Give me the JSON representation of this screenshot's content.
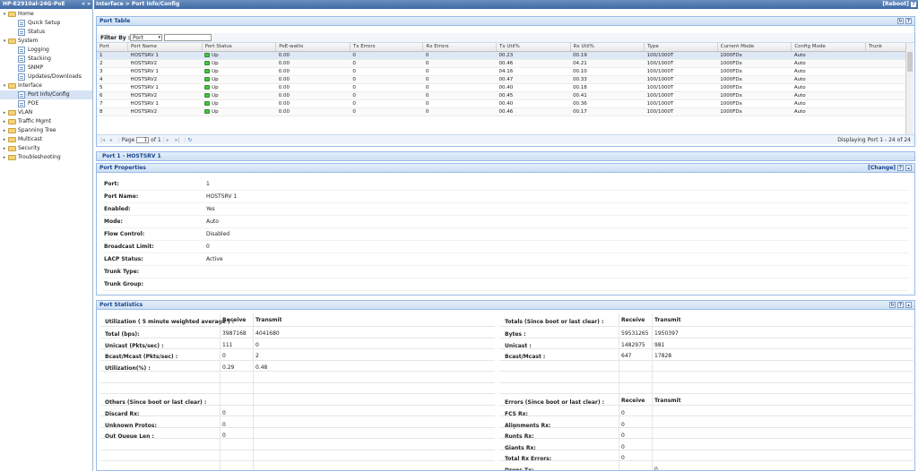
{
  "device": {
    "name": "HP-E2910al-24G-PoE",
    "nav_arrows": "« »"
  },
  "tree": [
    {
      "label": "Home",
      "type": "folder",
      "toggle": "▾",
      "level": 0
    },
    {
      "label": "Quick Setup",
      "type": "page",
      "level": 1
    },
    {
      "label": "Status",
      "type": "page",
      "level": 1
    },
    {
      "label": "System",
      "type": "folder",
      "toggle": "▾",
      "level": 0
    },
    {
      "label": "Logging",
      "type": "page",
      "level": 1
    },
    {
      "label": "Stacking",
      "type": "page",
      "level": 1
    },
    {
      "label": "SNMP",
      "type": "page",
      "level": 1
    },
    {
      "label": "Updates/Downloads",
      "type": "page",
      "level": 1
    },
    {
      "label": "Interface",
      "type": "folder",
      "toggle": "▾",
      "level": 0
    },
    {
      "label": "Port Info/Config",
      "type": "page",
      "level": 1,
      "selected": true
    },
    {
      "label": "POE",
      "type": "page",
      "level": 1
    },
    {
      "label": "VLAN",
      "type": "folder",
      "toggle": "▸",
      "level": 0
    },
    {
      "label": "Traffic Mgmt",
      "type": "folder",
      "toggle": "▸",
      "level": 0
    },
    {
      "label": "Spanning Tree",
      "type": "folder",
      "toggle": "▸",
      "level": 0
    },
    {
      "label": "Multicast",
      "type": "folder",
      "toggle": "▸",
      "level": 0
    },
    {
      "label": "Security",
      "type": "folder",
      "toggle": "▸",
      "level": 0
    },
    {
      "label": "Troubleshooting",
      "type": "folder",
      "toggle": "▸",
      "level": 0
    }
  ],
  "header": {
    "breadcrumb": "Interface > Port Info/Config",
    "reboot": "[Reboot]"
  },
  "port_table": {
    "title": "Port Table",
    "filter_label": "Filter By :",
    "filter_select": "Port",
    "columns": [
      "Port",
      "Port Name",
      "Port Status",
      "PoE-watts",
      "Tx Errors",
      "Rx Errors",
      "Tx Util%",
      "Rx Util%",
      "Type",
      "Current Mode",
      "Config Mode",
      "Trunk"
    ],
    "rows": [
      [
        "1",
        "HOSTSRV 1",
        "Up",
        "0.00",
        "0",
        "0",
        "00.23",
        "00.19",
        "100/1000T",
        "1000FDx",
        "Auto",
        ""
      ],
      [
        "2",
        "HOSTSRV2",
        "Up",
        "0.00",
        "0",
        "0",
        "00.46",
        "04.21",
        "100/1000T",
        "1000FDx",
        "Auto",
        ""
      ],
      [
        "3",
        "HOSTSRV 1",
        "Up",
        "0.00",
        "0",
        "0",
        "04.16",
        "00.10",
        "100/1000T",
        "1000FDx",
        "Auto",
        ""
      ],
      [
        "4",
        "HOSTSRV2",
        "Up",
        "0.00",
        "0",
        "0",
        "00.47",
        "00.33",
        "100/1000T",
        "1000FDx",
        "Auto",
        ""
      ],
      [
        "5",
        "HOSTSRV 1",
        "Up",
        "0.00",
        "0",
        "0",
        "00.40",
        "00.18",
        "100/1000T",
        "1000FDx",
        "Auto",
        ""
      ],
      [
        "6",
        "HOSTSRV2",
        "Up",
        "0.00",
        "0",
        "0",
        "00.45",
        "00.41",
        "100/1000T",
        "1000FDx",
        "Auto",
        ""
      ],
      [
        "7",
        "HOSTSRV 1",
        "Up",
        "0.00",
        "0",
        "0",
        "00.40",
        "00.36",
        "100/1000T",
        "1000FDx",
        "Auto",
        ""
      ],
      [
        "8",
        "HOSTSRV2",
        "Up",
        "0.00",
        "0",
        "0",
        "00.46",
        "00.17",
        "100/1000T",
        "1000FDx",
        "Auto",
        ""
      ]
    ],
    "pager": {
      "page_label": "Page",
      "page_value": "1",
      "of": "of 1",
      "display": "Displaying Port 1 - 24 of 24"
    }
  },
  "detail_title": "Port 1 - HOSTSRV 1",
  "port_properties": {
    "title": "Port Properties",
    "change": "[Change]",
    "rows": [
      {
        "k": "Port:",
        "v": "1"
      },
      {
        "k": "Port Name:",
        "v": "HOSTSRV 1"
      },
      {
        "k": "Enabled:",
        "v": "Yes"
      },
      {
        "k": "Mode:",
        "v": "Auto"
      },
      {
        "k": "Flow Control:",
        "v": "Disabled"
      },
      {
        "k": "Broadcast Limit:",
        "v": "0"
      },
      {
        "k": "LACP Status:",
        "v": "Active"
      },
      {
        "k": "Trunk Type:",
        "v": ""
      },
      {
        "k": "Trunk Group:",
        "v": ""
      }
    ]
  },
  "port_statistics": {
    "title": "Port Statistics",
    "util_header": "Utilization ( 5 minute weighted average ) :",
    "receive": "Receive",
    "transmit": "Transmit",
    "left": [
      {
        "k": "Total (bps):",
        "r": "3987168",
        "t": "4041680"
      },
      {
        "k": "Unicast (Pkts/sec) :",
        "r": "111",
        "t": "0"
      },
      {
        "k": "Bcast/Mcast (Pkts/sec) :",
        "r": "0",
        "t": "2"
      },
      {
        "k": "Utilization(%) :",
        "r": "0.29",
        "t": "0.48"
      }
    ],
    "totals_header": "Totals (Since boot or last clear) :",
    "right": [
      {
        "k": "Bytes :",
        "r": "59531265",
        "t": "1950397"
      },
      {
        "k": "Unicast :",
        "r": "1482975",
        "t": "981"
      },
      {
        "k": "Bcast/Mcast :",
        "r": "647",
        "t": "17828"
      }
    ],
    "others_header": "Others (Since boot or last clear) :",
    "others": [
      {
        "k": "Discard Rx:",
        "v": "0"
      },
      {
        "k": "Unknown Protos:",
        "v": "0"
      },
      {
        "k": "Out Queue Len :",
        "v": "0"
      }
    ],
    "errors_header": "Errors (Since boot or last clear) :",
    "errors": [
      {
        "k": "FCS Rx:",
        "r": "0",
        "t": ""
      },
      {
        "k": "Alignments Rx:",
        "r": "0",
        "t": ""
      },
      {
        "k": "Runts Rx:",
        "r": "0",
        "t": ""
      },
      {
        "k": "Giants Rx:",
        "r": "0",
        "t": ""
      },
      {
        "k": "Total Rx Errors:",
        "r": "0",
        "t": ""
      },
      {
        "k": "Drops Tx:",
        "r": "",
        "t": "0"
      }
    ]
  }
}
